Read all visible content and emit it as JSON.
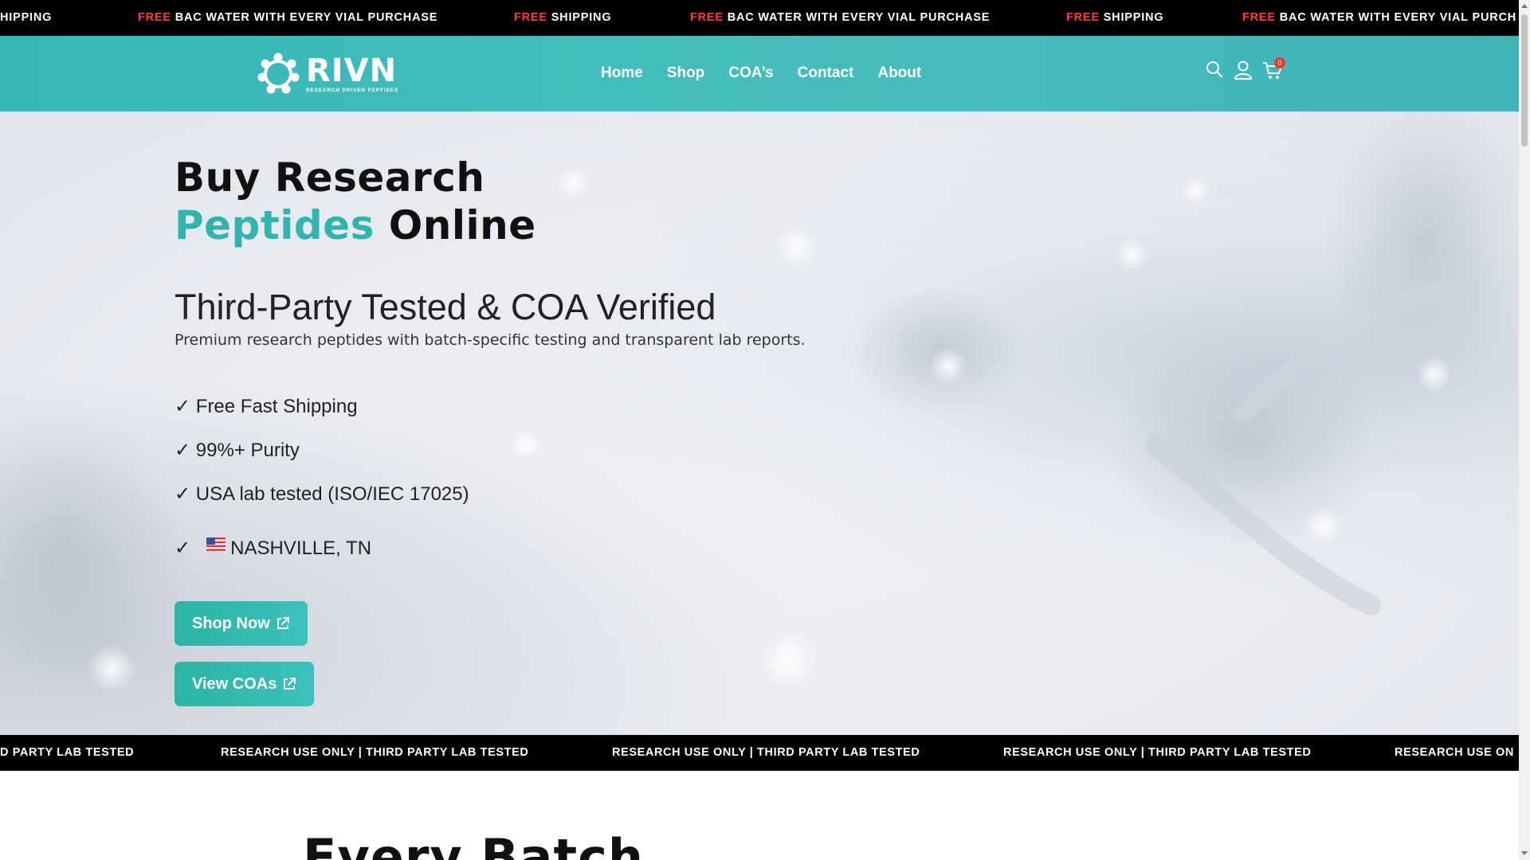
{
  "announcement": {
    "items": [
      {
        "red": "",
        "text": "HIPPING"
      },
      {
        "red": "FREE",
        "text": " BAC WATER WITH EVERY VIAL PURCHASE"
      },
      {
        "red": "FREE",
        "text": " SHIPPING"
      },
      {
        "red": "FREE",
        "text": " BAC WATER WITH EVERY VIAL PURCHASE"
      },
      {
        "red": "FREE",
        "text": " SHIPPING"
      },
      {
        "red": "FREE",
        "text": " BAC WATER WITH EVERY VIAL PURCH"
      }
    ]
  },
  "header": {
    "logo_word": "RIVN",
    "logo_tagline": "RESEARCH DRIVEN PEPTIDES",
    "nav": [
      "Home",
      "Shop",
      "COA’s",
      "Contact",
      "About"
    ],
    "cart_count": "0",
    "icons": [
      "search-icon",
      "account-icon",
      "cart-icon"
    ]
  },
  "hero": {
    "title_line1": "Buy Research",
    "title_accent": "Peptides",
    "title_rest": " Online",
    "subtitle": "Third-Party Tested & COA Verified",
    "description": "Premium research peptides with batch-specific testing and transparent lab reports.",
    "features": [
      "✓  Free Fast Shipping",
      "✓  99%+ Purity",
      "✓ USA lab tested (ISO/IEC 17025)",
      "NASHVILLE, TN"
    ],
    "location_check": "✓",
    "buttons": {
      "shop": "Shop Now",
      "coas": "View COAs"
    }
  },
  "ticker": {
    "items": [
      "D PARTY LAB TESTED",
      "RESEARCH USE ONLY | THIRD PARTY LAB TESTED",
      "RESEARCH USE ONLY | THIRD PARTY LAB TESTED",
      "RESEARCH USE ONLY | THIRD PARTY LAB TESTED",
      "RESEARCH USE ON"
    ]
  },
  "next_section": {
    "title_partial": "Every Batch"
  },
  "colors": {
    "accent": "#2fb5ae",
    "header": "#40bab9",
    "badge": "#e53935",
    "free_red": "#ff3b3b"
  }
}
